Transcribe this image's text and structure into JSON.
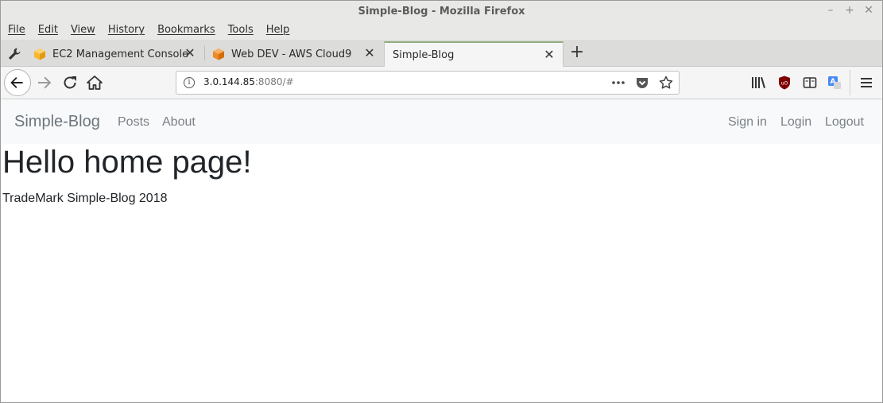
{
  "window": {
    "title": "Simple-Blog - Mozilla Firefox",
    "controls": {
      "minimize": "–",
      "maximize": "+",
      "close": "✕"
    }
  },
  "menu": [
    "File",
    "Edit",
    "View",
    "History",
    "Bookmarks",
    "Tools",
    "Help"
  ],
  "tabs": [
    {
      "label": "EC2 Management Console",
      "icon": "aws-cube-yellow-icon"
    },
    {
      "label": "Web DEV - AWS Cloud9",
      "icon": "aws-cube-orange-icon"
    },
    {
      "label": "Simple-Blog",
      "icon": "none",
      "active": true
    }
  ],
  "url": {
    "host": "3.0.144.85",
    "rest": ":8080/#"
  },
  "site": {
    "brand": "Simple-Blog",
    "nav_left": [
      "Posts",
      "About"
    ],
    "nav_right": [
      "Sign in",
      "Login",
      "Logout"
    ],
    "heading": "Hello home page!",
    "footer": "TradeMark Simple-Blog 2018"
  },
  "colors": {
    "active_tab_accent": "#8fae7e",
    "navbar_bg": "#f8f9fa"
  }
}
